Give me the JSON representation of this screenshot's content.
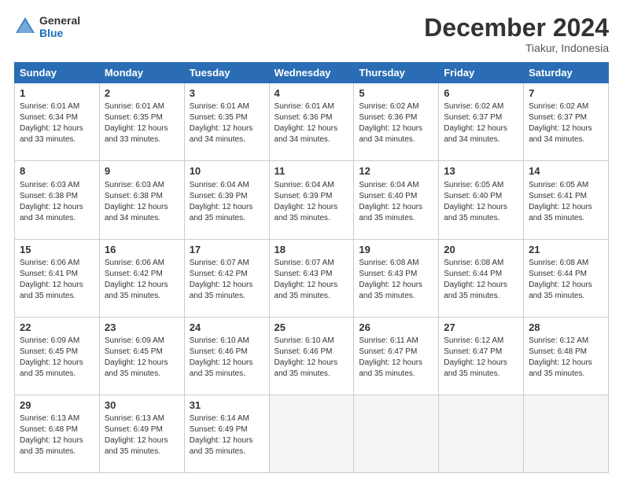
{
  "header": {
    "logo_general": "General",
    "logo_blue": "Blue",
    "title": "December 2024",
    "subtitle": "Tiakur, Indonesia"
  },
  "days_of_week": [
    "Sunday",
    "Monday",
    "Tuesday",
    "Wednesday",
    "Thursday",
    "Friday",
    "Saturday"
  ],
  "weeks": [
    [
      {
        "num": "1",
        "sunrise": "6:01 AM",
        "sunset": "6:34 PM",
        "daylight": "12 hours and 33 minutes."
      },
      {
        "num": "2",
        "sunrise": "6:01 AM",
        "sunset": "6:35 PM",
        "daylight": "12 hours and 33 minutes."
      },
      {
        "num": "3",
        "sunrise": "6:01 AM",
        "sunset": "6:35 PM",
        "daylight": "12 hours and 34 minutes."
      },
      {
        "num": "4",
        "sunrise": "6:01 AM",
        "sunset": "6:36 PM",
        "daylight": "12 hours and 34 minutes."
      },
      {
        "num": "5",
        "sunrise": "6:02 AM",
        "sunset": "6:36 PM",
        "daylight": "12 hours and 34 minutes."
      },
      {
        "num": "6",
        "sunrise": "6:02 AM",
        "sunset": "6:37 PM",
        "daylight": "12 hours and 34 minutes."
      },
      {
        "num": "7",
        "sunrise": "6:02 AM",
        "sunset": "6:37 PM",
        "daylight": "12 hours and 34 minutes."
      }
    ],
    [
      {
        "num": "8",
        "sunrise": "6:03 AM",
        "sunset": "6:38 PM",
        "daylight": "12 hours and 34 minutes."
      },
      {
        "num": "9",
        "sunrise": "6:03 AM",
        "sunset": "6:38 PM",
        "daylight": "12 hours and 34 minutes."
      },
      {
        "num": "10",
        "sunrise": "6:04 AM",
        "sunset": "6:39 PM",
        "daylight": "12 hours and 35 minutes."
      },
      {
        "num": "11",
        "sunrise": "6:04 AM",
        "sunset": "6:39 PM",
        "daylight": "12 hours and 35 minutes."
      },
      {
        "num": "12",
        "sunrise": "6:04 AM",
        "sunset": "6:40 PM",
        "daylight": "12 hours and 35 minutes."
      },
      {
        "num": "13",
        "sunrise": "6:05 AM",
        "sunset": "6:40 PM",
        "daylight": "12 hours and 35 minutes."
      },
      {
        "num": "14",
        "sunrise": "6:05 AM",
        "sunset": "6:41 PM",
        "daylight": "12 hours and 35 minutes."
      }
    ],
    [
      {
        "num": "15",
        "sunrise": "6:06 AM",
        "sunset": "6:41 PM",
        "daylight": "12 hours and 35 minutes."
      },
      {
        "num": "16",
        "sunrise": "6:06 AM",
        "sunset": "6:42 PM",
        "daylight": "12 hours and 35 minutes."
      },
      {
        "num": "17",
        "sunrise": "6:07 AM",
        "sunset": "6:42 PM",
        "daylight": "12 hours and 35 minutes."
      },
      {
        "num": "18",
        "sunrise": "6:07 AM",
        "sunset": "6:43 PM",
        "daylight": "12 hours and 35 minutes."
      },
      {
        "num": "19",
        "sunrise": "6:08 AM",
        "sunset": "6:43 PM",
        "daylight": "12 hours and 35 minutes."
      },
      {
        "num": "20",
        "sunrise": "6:08 AM",
        "sunset": "6:44 PM",
        "daylight": "12 hours and 35 minutes."
      },
      {
        "num": "21",
        "sunrise": "6:08 AM",
        "sunset": "6:44 PM",
        "daylight": "12 hours and 35 minutes."
      }
    ],
    [
      {
        "num": "22",
        "sunrise": "6:09 AM",
        "sunset": "6:45 PM",
        "daylight": "12 hours and 35 minutes."
      },
      {
        "num": "23",
        "sunrise": "6:09 AM",
        "sunset": "6:45 PM",
        "daylight": "12 hours and 35 minutes."
      },
      {
        "num": "24",
        "sunrise": "6:10 AM",
        "sunset": "6:46 PM",
        "daylight": "12 hours and 35 minutes."
      },
      {
        "num": "25",
        "sunrise": "6:10 AM",
        "sunset": "6:46 PM",
        "daylight": "12 hours and 35 minutes."
      },
      {
        "num": "26",
        "sunrise": "6:11 AM",
        "sunset": "6:47 PM",
        "daylight": "12 hours and 35 minutes."
      },
      {
        "num": "27",
        "sunrise": "6:12 AM",
        "sunset": "6:47 PM",
        "daylight": "12 hours and 35 minutes."
      },
      {
        "num": "28",
        "sunrise": "6:12 AM",
        "sunset": "6:48 PM",
        "daylight": "12 hours and 35 minutes."
      }
    ],
    [
      {
        "num": "29",
        "sunrise": "6:13 AM",
        "sunset": "6:48 PM",
        "daylight": "12 hours and 35 minutes."
      },
      {
        "num": "30",
        "sunrise": "6:13 AM",
        "sunset": "6:49 PM",
        "daylight": "12 hours and 35 minutes."
      },
      {
        "num": "31",
        "sunrise": "6:14 AM",
        "sunset": "6:49 PM",
        "daylight": "12 hours and 35 minutes."
      },
      null,
      null,
      null,
      null
    ]
  ]
}
